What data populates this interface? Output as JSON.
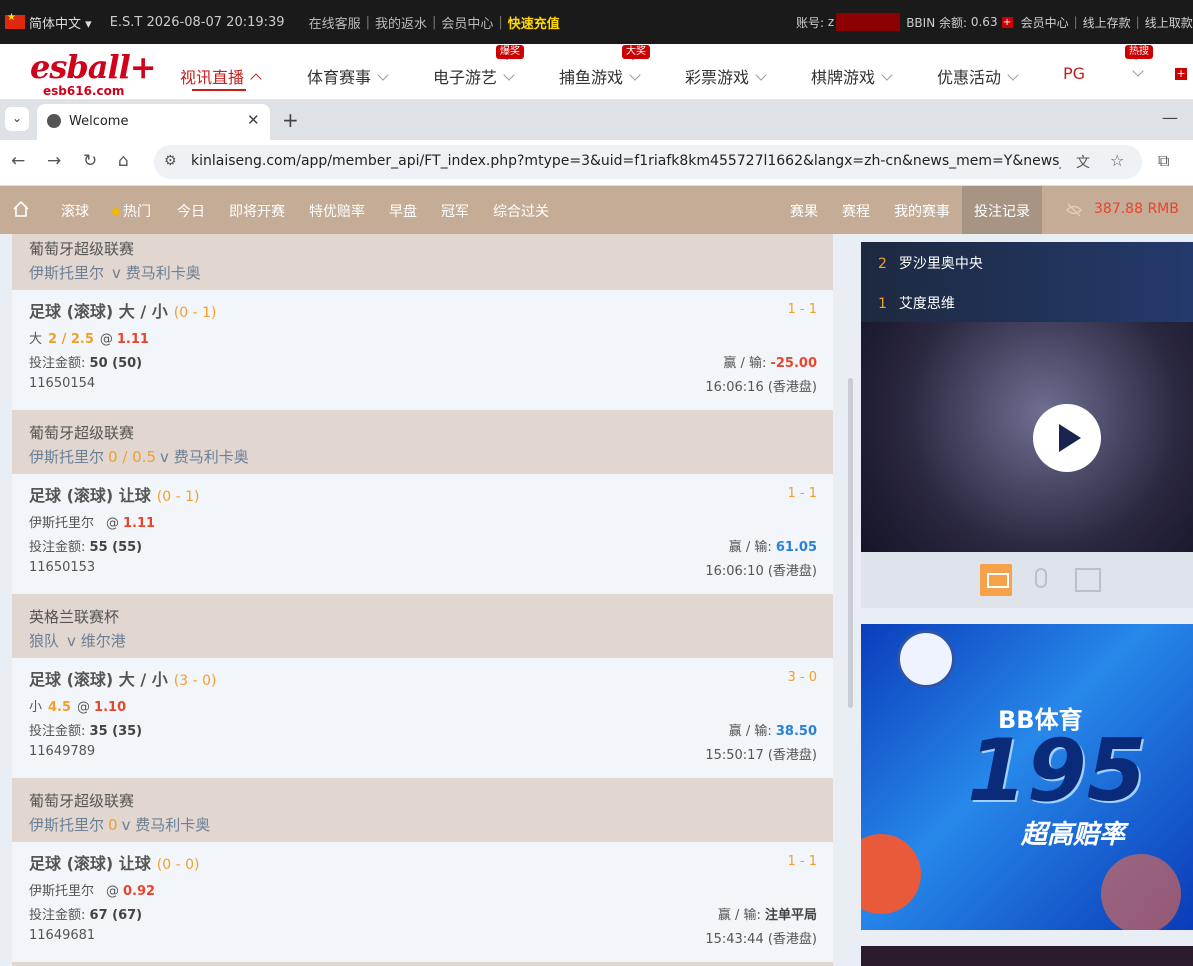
{
  "topbar": {
    "language": "简体中文",
    "clock": "E.S.T 2026-08-07 20:19:39",
    "links": [
      "在线客服",
      "我的返水",
      "会员中心"
    ],
    "recharge": "快速充值",
    "account_label": "账号:",
    "account_prefix": "z",
    "balance_label": "BBIN 余额:",
    "balance_value": "0.63",
    "right_links": [
      "会员中心",
      "线上存款",
      "线上取款"
    ]
  },
  "logo": {
    "main": "esball+",
    "domain": "esb616.com"
  },
  "nav": {
    "items": [
      {
        "label": "视讯直播",
        "badge": ""
      },
      {
        "label": "体育赛事",
        "badge": ""
      },
      {
        "label": "电子游艺",
        "badge": "爆奖"
      },
      {
        "label": "捕鱼游戏",
        "badge": "大奖"
      },
      {
        "label": "彩票游戏",
        "badge": ""
      },
      {
        "label": "棋牌游戏",
        "badge": ""
      },
      {
        "label": "优惠活动",
        "badge": ""
      },
      {
        "label": "PG",
        "badge": ""
      },
      {
        "label": "",
        "badge": "热搜"
      }
    ]
  },
  "browser": {
    "tab_title": "Welcome",
    "url": "kinlaiseng.com/app/member_api/FT_index.php?mtype=3&uid=f1riafk8km455727l1662&langx=zh-cn&news_mem=Y&news_api..."
  },
  "subnav": {
    "left": [
      "滚球",
      "热门",
      "今日",
      "即将开赛",
      "特优赔率",
      "早盘",
      "冠军",
      "综合过关"
    ],
    "right": [
      "赛果",
      "赛程",
      "我的赛事",
      "投注记录"
    ],
    "balance": "387.88",
    "currency": "RMB"
  },
  "bets": [
    {
      "league": "葡萄牙超级联赛",
      "home": "伊斯托里尔",
      "handicap": "",
      "vs": "v",
      "away": "费马利卡奥",
      "type": "足球 (滚球) 大 / 小",
      "type_score": "(0 - 1)",
      "score": "1 - 1",
      "selection": "大",
      "sel_value": "2 / 2.5",
      "at": "@",
      "odds": "1.11",
      "amount_label": "投注金额:",
      "amount": "50 (50)",
      "winloss_label": "赢 / 输:",
      "winloss": "-25.00",
      "order_id": "11650154",
      "time": "16:06:16 (香港盘)"
    },
    {
      "league": "葡萄牙超级联赛",
      "home": "伊斯托里尔",
      "handicap": "0 / 0.5",
      "vs": "v",
      "away": "费马利卡奥",
      "type": "足球 (滚球) 让球",
      "type_score": "(0 - 1)",
      "score": "1 - 1",
      "selection": "伊斯托里尔",
      "sel_value": "",
      "at": "@",
      "odds": "1.11",
      "amount_label": "投注金额:",
      "amount": "55 (55)",
      "winloss_label": "赢 / 输:",
      "winloss": "61.05",
      "order_id": "11650153",
      "time": "16:06:10 (香港盘)"
    },
    {
      "league": "英格兰联赛杯",
      "home": "狼队",
      "handicap": "",
      "vs": "v",
      "away": "维尔港",
      "type": "足球 (滚球) 大 / 小",
      "type_score": "(3 - 0)",
      "score": "3 - 0",
      "selection": "小",
      "sel_value": "4.5",
      "at": "@",
      "odds": "1.10",
      "amount_label": "投注金额:",
      "amount": "35 (35)",
      "winloss_label": "赢 / 输:",
      "winloss": "38.50",
      "order_id": "11649789",
      "time": "15:50:17 (香港盘)"
    },
    {
      "league": "葡萄牙超级联赛",
      "home": "伊斯托里尔",
      "handicap": "0",
      "vs": "v",
      "away": "费马利卡奥",
      "type": "足球 (滚球) 让球",
      "type_score": "(0 - 0)",
      "score": "1 - 1",
      "selection": "伊斯托里尔",
      "sel_value": "",
      "at": "@",
      "odds": "0.92",
      "amount_label": "投注金额:",
      "amount": "67 (67)",
      "winloss_label": "赢 / 输:",
      "winloss": "注单平局",
      "order_id": "11649681",
      "time": "15:43:44 (香港盘)"
    }
  ],
  "sidebar": {
    "rank": [
      {
        "n": "2",
        "name": "罗沙里奥中央"
      },
      {
        "n": "1",
        "name": "艾度思维"
      }
    ],
    "promo": {
      "brand": "BB体育",
      "number": "195",
      "tagline": "超高赔率"
    }
  },
  "colors": {
    "accent": "#c81e1e",
    "subnav": "#c5ac97",
    "orange": "#f2a02c",
    "loss": "#e8452c",
    "win": "#2a80d8"
  }
}
